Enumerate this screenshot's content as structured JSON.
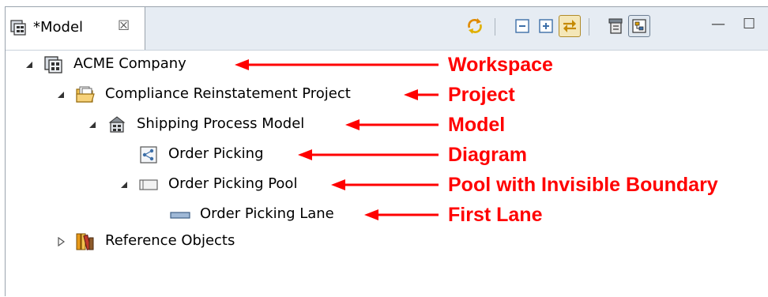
{
  "tab": {
    "title": "*Model",
    "close_glyph": "☒",
    "icon": "model-view-icon"
  },
  "toolbar": {
    "buttons": [
      {
        "name": "sync-icon"
      },
      {
        "name": "collapse-all-icon"
      },
      {
        "name": "expand-all-icon"
      },
      {
        "name": "link-with-editor-icon"
      },
      {
        "name": "filter-icon"
      },
      {
        "name": "tree-layout-icon"
      }
    ],
    "minimize_glyph": "—",
    "maximize_glyph": "☐"
  },
  "tree": [
    {
      "label": "ACME Company",
      "icon": "workspace-icon",
      "expanded": true
    },
    {
      "label": "Compliance Reinstatement Project",
      "icon": "project-folder-icon",
      "expanded": true
    },
    {
      "label": "Shipping Process Model",
      "icon": "model-icon",
      "expanded": true
    },
    {
      "label": "Order Picking",
      "icon": "diagram-icon",
      "expanded": null
    },
    {
      "label": "Order Picking Pool",
      "icon": "pool-icon",
      "expanded": true
    },
    {
      "label": "Order Picking Lane",
      "icon": "lane-icon",
      "expanded": null
    },
    {
      "label": "Reference Objects",
      "icon": "reference-books-icon",
      "expanded": false
    }
  ],
  "annotations": [
    {
      "label": "Workspace"
    },
    {
      "label": "Project"
    },
    {
      "label": "Model"
    },
    {
      "label": "Diagram"
    },
    {
      "label": "Pool with Invisible Boundary"
    },
    {
      "label": "First Lane"
    }
  ],
  "colors": {
    "annotation": "#ff0000",
    "tabbar": "#e6ecf3",
    "pressed": "#f4e7b8"
  }
}
